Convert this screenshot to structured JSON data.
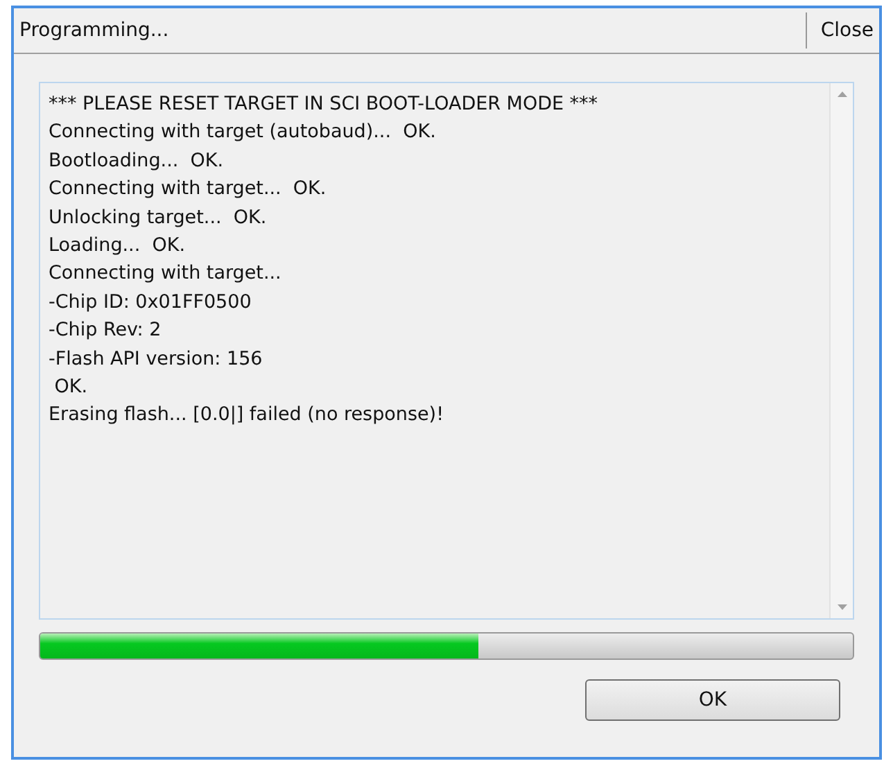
{
  "window": {
    "title": "Programming...",
    "close_label": "Close"
  },
  "log": {
    "lines": [
      "*** PLEASE RESET TARGET IN SCI BOOT-LOADER MODE ***",
      "Connecting with target (autobaud)...  OK.",
      "Bootloading...  OK.",
      "Connecting with target...  OK.",
      "Unlocking target...  OK.",
      "Loading...  OK.",
      "Connecting with target...",
      "-Chip ID: 0x01FF0500",
      "-Chip Rev: 2",
      "-Flash API version: 156",
      " OK.",
      "Erasing flash... [0.0|] failed (no response)!"
    ]
  },
  "progress": {
    "level": 0.54
  },
  "buttons": [
    "OK"
  ]
}
